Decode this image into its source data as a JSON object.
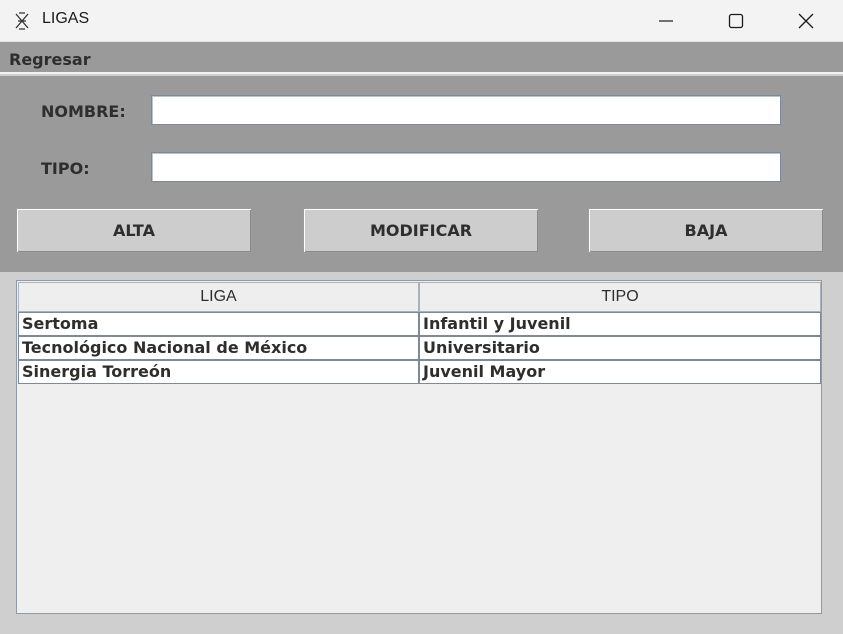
{
  "window": {
    "title": "LIGAS",
    "icon": "app-icon",
    "controls": [
      "minimize-icon",
      "maximize-icon",
      "close-icon"
    ]
  },
  "menu": {
    "items": [
      {
        "label": "Regresar"
      }
    ]
  },
  "form": {
    "nombre_label": "NOMBRE:",
    "nombre_value": "",
    "tipo_label": "TIPO:",
    "tipo_value": ""
  },
  "buttons": {
    "alta": "ALTA",
    "modificar": "MODIFICAR",
    "baja": "BAJA"
  },
  "table": {
    "columns": [
      "LIGA",
      "TIPO"
    ],
    "rows": [
      [
        "Sertoma",
        "Infantil y Juvenil"
      ],
      [
        "Tecnológico Nacional de México",
        "Universitario"
      ],
      [
        "Sinergia Torreón",
        "Juvenil Mayor"
      ]
    ]
  },
  "colors": {
    "panel": "#9a9a9a",
    "frame": "#cfcfcf",
    "button": "#cdcdcd",
    "table_bg": "#efefef"
  }
}
